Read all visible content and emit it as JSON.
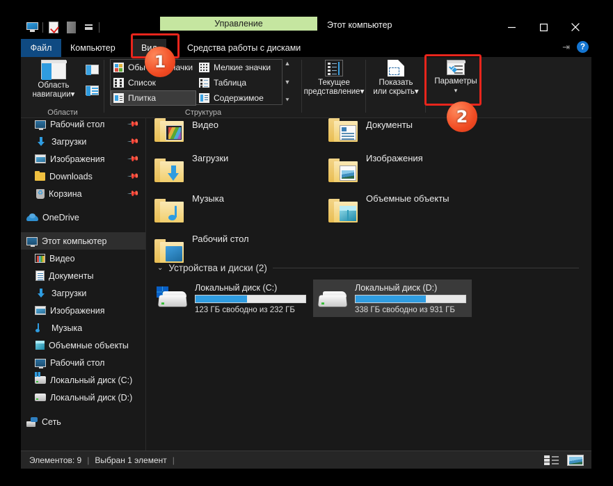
{
  "window": {
    "title": "Этот компьютер",
    "contextual_tab_header": "Управление",
    "minimize_label": "Свернуть",
    "maximize_label": "Развернуть",
    "close_label": "Закрыть"
  },
  "quick_access": {
    "items": [
      {
        "name": "this-pc-icon",
        "tooltip": "Этот компьютер"
      },
      {
        "name": "properties-icon",
        "tooltip": "Свойства"
      },
      {
        "name": "window-icon",
        "tooltip": "Окно"
      },
      {
        "name": "customize-dropdown-icon",
        "tooltip": "Настройка панели быстрого доступа"
      }
    ]
  },
  "tabs": [
    {
      "label": "Файл",
      "active": false,
      "name": "tab-file"
    },
    {
      "label": "Компьютер",
      "active": false,
      "name": "tab-computer"
    },
    {
      "label": "Вид",
      "active": true,
      "name": "tab-view"
    },
    {
      "label": "Средства работы с дисками",
      "active": false,
      "name": "tab-drive-tools"
    }
  ],
  "tab_helpers": {
    "pin_label": "⇥",
    "help_label": "?"
  },
  "ribbon": {
    "groups": [
      {
        "label": "Области"
      },
      {
        "label": "Структура"
      }
    ],
    "nav_pane": {
      "label": "Область\nнавигации",
      "label_line1": "Область",
      "label_line2": "навигации",
      "caret": "▾"
    },
    "layout_views": [
      {
        "label": "Обычные значки",
        "selected": false,
        "icon": "medium-icons-icon"
      },
      {
        "label": "Мелкие значки",
        "selected": false,
        "icon": "small-icons-icon"
      },
      {
        "label": "Список",
        "selected": false,
        "icon": "list-view-icon"
      },
      {
        "label": "Таблица",
        "selected": false,
        "icon": "details-view-icon"
      },
      {
        "label": "Плитка",
        "selected": true,
        "icon": "tiles-view-icon"
      },
      {
        "label": "Содержимое",
        "selected": false,
        "icon": "content-view-icon"
      }
    ],
    "scroll_up": "▲",
    "scroll_down": "▼",
    "scroll_more": "⯆",
    "buttons": [
      {
        "name": "current-view-button",
        "label_line1": "Текущее",
        "label_line2": "представление",
        "caret": "▾",
        "icon": "current-view-icon"
      },
      {
        "name": "show-hide-button",
        "label_line1": "Показать",
        "label_line2": "или скрыть",
        "caret": "▾",
        "icon": "show-hide-icon"
      },
      {
        "name": "options-button",
        "label_line1": "Параметры",
        "label_line2": "",
        "caret": "▾",
        "icon": "options-icon"
      }
    ]
  },
  "sidebar": {
    "items": [
      {
        "label": "Рабочий стол",
        "icon": "desktop-icon",
        "indent": 1,
        "pinned": true,
        "selected": false
      },
      {
        "label": "Загрузки",
        "icon": "downloads-icon",
        "indent": 1,
        "pinned": true,
        "selected": false
      },
      {
        "label": "Изображения",
        "icon": "pictures-icon",
        "indent": 1,
        "pinned": true,
        "selected": false
      },
      {
        "label": "Downloads",
        "icon": "folder-icon",
        "indent": 1,
        "pinned": true,
        "selected": false
      },
      {
        "label": "Корзина",
        "icon": "recycle-bin-icon",
        "indent": 1,
        "pinned": true,
        "selected": false
      },
      {
        "label": "OneDrive",
        "icon": "onedrive-cloud-icon",
        "indent": 0,
        "pinned": false,
        "selected": false
      },
      {
        "label": "Этот компьютер",
        "icon": "this-pc-icon",
        "indent": 0,
        "pinned": false,
        "selected": true
      },
      {
        "label": "Видео",
        "icon": "videos-icon",
        "indent": 1,
        "pinned": false,
        "selected": false
      },
      {
        "label": "Документы",
        "icon": "documents-icon",
        "indent": 1,
        "pinned": false,
        "selected": false
      },
      {
        "label": "Загрузки",
        "icon": "downloads-icon",
        "indent": 1,
        "pinned": false,
        "selected": false
      },
      {
        "label": "Изображения",
        "icon": "pictures-icon",
        "indent": 1,
        "pinned": false,
        "selected": false
      },
      {
        "label": "Музыка",
        "icon": "music-icon",
        "indent": 1,
        "pinned": false,
        "selected": false
      },
      {
        "label": "Объемные объекты",
        "icon": "3d-objects-icon",
        "indent": 1,
        "pinned": false,
        "selected": false
      },
      {
        "label": "Рабочий стол",
        "icon": "desktop-icon",
        "indent": 1,
        "pinned": false,
        "selected": false
      },
      {
        "label": "Локальный диск (C:)",
        "icon": "windows-drive-icon",
        "indent": 1,
        "pinned": false,
        "selected": false
      },
      {
        "label": "Локальный диск (D:)",
        "icon": "drive-icon",
        "indent": 1,
        "pinned": false,
        "selected": false
      },
      {
        "label": "Сеть",
        "icon": "network-icon",
        "indent": 0,
        "pinned": false,
        "selected": false
      }
    ]
  },
  "content": {
    "folders": [
      {
        "label": "Видео",
        "icon": "videos-folder-icon",
        "col": 0,
        "row": 0
      },
      {
        "label": "Документы",
        "icon": "documents-folder-icon",
        "col": 1,
        "row": 0
      },
      {
        "label": "Загрузки",
        "icon": "downloads-folder-icon",
        "col": 0,
        "row": 1
      },
      {
        "label": "Изображения",
        "icon": "pictures-folder-icon",
        "col": 1,
        "row": 1
      },
      {
        "label": "Музыка",
        "icon": "music-folder-icon",
        "col": 0,
        "row": 2
      },
      {
        "label": "Объемные объекты",
        "icon": "3d-objects-folder-icon",
        "col": 1,
        "row": 2
      },
      {
        "label": "Рабочий стол",
        "icon": "desktop-folder-icon",
        "col": 0,
        "row": 3
      }
    ],
    "drives_section": {
      "header": "Устройства и диски (2)",
      "chevron": "⌄",
      "drives": [
        {
          "name": "Локальный диск (C:)",
          "free_text": "123 ГБ свободно из 232 ГБ",
          "used_percent": 47,
          "icon": "windows-drive-icon",
          "selected": false
        },
        {
          "name": "Локальный диск (D:)",
          "free_text": "338 ГБ свободно из 931 ГБ",
          "used_percent": 64,
          "icon": "drive-icon",
          "selected": true
        }
      ]
    }
  },
  "status_bar": {
    "item_count": "Элементов: 9",
    "selection": "Выбран 1 элемент",
    "separator": "|",
    "view_buttons": [
      {
        "name": "details-view-button",
        "tooltip": "Таблица"
      },
      {
        "name": "large-icons-view-button",
        "tooltip": "Крупные значки"
      }
    ]
  },
  "annotations": {
    "badges": [
      {
        "label": "1",
        "target": "tab-view"
      },
      {
        "label": "2",
        "target": "options-button"
      }
    ],
    "highlight_color": "#e8251c"
  },
  "colors": {
    "accent_blue": "#2f9ce0",
    "file_tab_blue": "#0f4a82",
    "contextual_green": "#c5e6a0",
    "badge_orange": "#f04a22",
    "folder_yellow": "#f2cf6d",
    "window_bg": "#191919"
  }
}
